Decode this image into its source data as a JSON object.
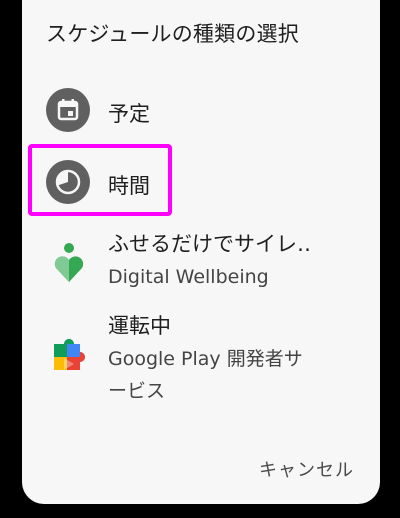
{
  "dialog": {
    "title": "スケジュールの種類の選択",
    "options": [
      {
        "label": "予定",
        "icon": "calendar-icon"
      },
      {
        "label": "時間",
        "icon": "clock-icon"
      },
      {
        "label": "ふせるだけでサイレ‥",
        "sub": "Digital Wellbeing",
        "icon": "digital-wellbeing-icon"
      },
      {
        "label": "運転中",
        "sub_line1": "Google Play 開発者サ",
        "sub_line2": "ービス",
        "icon": "google-play-services-icon"
      }
    ],
    "cancel_label": "キャンセル"
  },
  "colors": {
    "dialog_bg": "#f7f7f7",
    "icon_gray": "#606060",
    "highlight": "#ff00ff"
  }
}
